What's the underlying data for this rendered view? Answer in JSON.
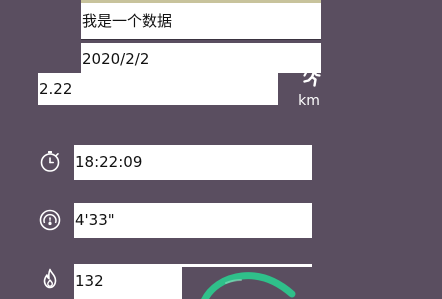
{
  "record": {
    "title": "我是一个数据",
    "date": "2020/2/2",
    "distance": "2.22",
    "distance_unit": "km"
  },
  "stats": {
    "duration": "18:22:09",
    "pace": "4'33\"",
    "calories": "132"
  },
  "icons": {
    "activity": "running-person-icon",
    "duration": "stopwatch-icon",
    "pace": "speedometer-icon",
    "calories": "flame-icon",
    "route": "route-track"
  },
  "colors": {
    "background": "#5a4e60",
    "field": "#ffffff",
    "route": "#2fc08a",
    "icon": "#ffffff"
  }
}
